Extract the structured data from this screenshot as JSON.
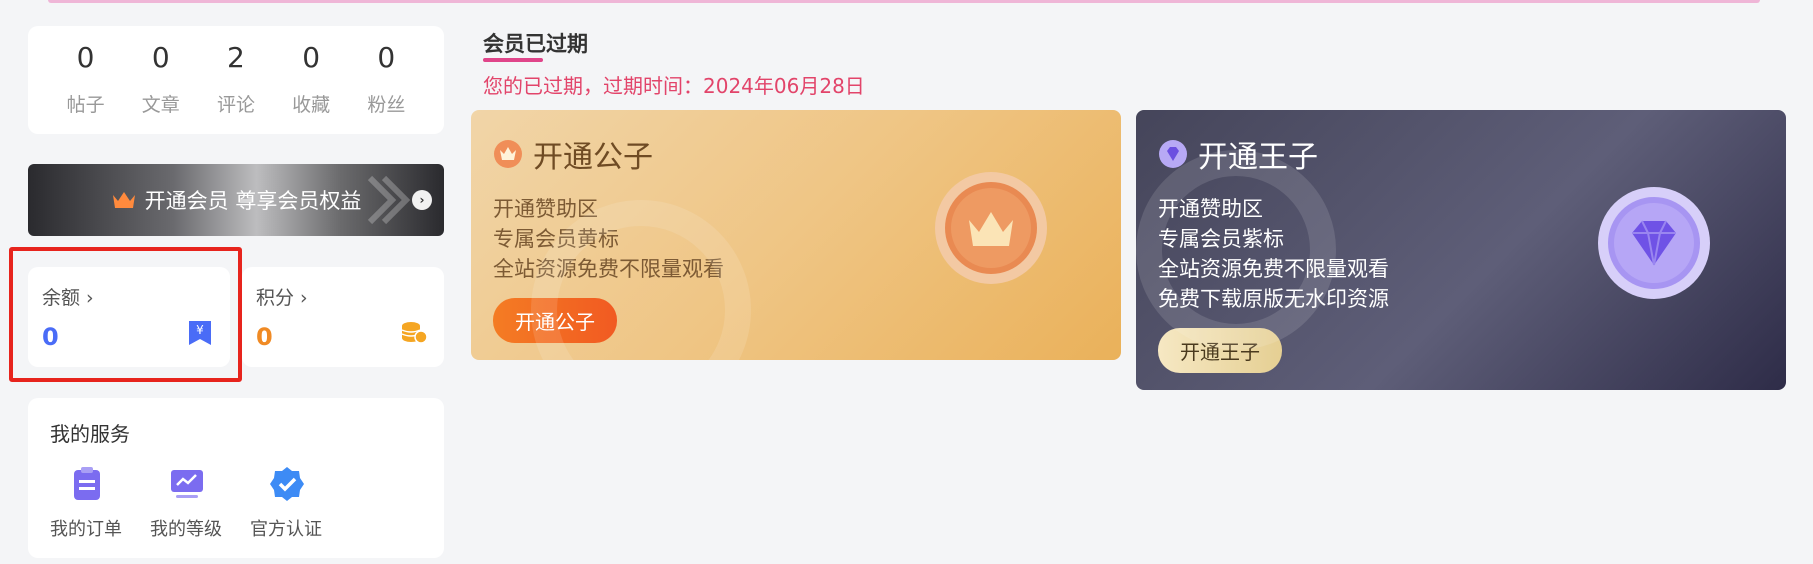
{
  "stats": [
    {
      "value": "0",
      "label": "帖子"
    },
    {
      "value": "0",
      "label": "文章"
    },
    {
      "value": "2",
      "label": "评论"
    },
    {
      "value": "0",
      "label": "收藏"
    },
    {
      "value": "0",
      "label": "粉丝"
    }
  ],
  "vip_banner": {
    "text": "开通会员 尊享会员权益"
  },
  "balance": {
    "label": "余额 ›",
    "value": "0",
    "color": "#4a6cf7"
  },
  "points": {
    "label": "积分 ›",
    "value": "0",
    "color": "#f08a24"
  },
  "services": {
    "title": "我的服务",
    "items": [
      {
        "label": "我的订单",
        "icon": "order-icon"
      },
      {
        "label": "我的等级",
        "icon": "level-icon"
      },
      {
        "label": "官方认证",
        "icon": "verified-icon"
      }
    ]
  },
  "membership": {
    "status_title": "会员已过期",
    "expire_message": "您的已过期，过期时间：2024年06月28日",
    "plans": [
      {
        "name": "开通公子",
        "benefits": [
          "开通赞助区",
          "专属会员黄标",
          "全站资源免费不限量观看"
        ],
        "button": "开通公子"
      },
      {
        "name": "开通王子",
        "benefits": [
          "开通赞助区",
          "专属会员紫标",
          "全站资源免费不限量观看",
          "免费下载原版无水印资源"
        ],
        "button": "开通王子"
      }
    ]
  }
}
